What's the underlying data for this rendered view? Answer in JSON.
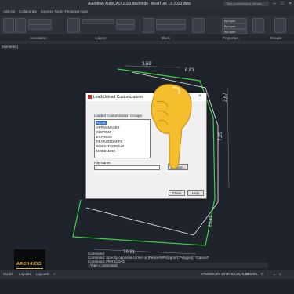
{
  "window": {
    "title": "Autodesk AutoCAD 2023  dashinde_WestTurk 19 2023.dwg",
    "search_placeholder": "Type a keyword or phrase"
  },
  "menu": {
    "items": [
      "Add-ins",
      "Collaborate",
      "Express Tools",
      "Featured Apps"
    ]
  },
  "ribbon": {
    "panels": [
      "Annotation",
      "Layers",
      "Block",
      "Properties",
      "Groups"
    ],
    "layer_value": "ByLayer"
  },
  "document_tab": "[Isometric]",
  "dimensions": {
    "d1": "3,59",
    "d2": "6,83",
    "d3": "2,67",
    "d4": "7,25",
    "d5": "13,47",
    "d6": "16,91"
  },
  "dialog": {
    "title": "Load/Unload Customizations",
    "group_label": "Loaded Customization Groups:",
    "groups": [
      "ACAD",
      "APPMANAGER",
      "CUSTOM",
      "EXPRESS",
      "FEATUREDAPPS",
      "INSIGHTSGROUP",
      "MODELDOC"
    ],
    "selected_index": 0,
    "file_label": "File Name:",
    "file_value": "",
    "browse": "Browse...",
    "close": "Close",
    "help": "Help"
  },
  "command": {
    "history": [
      "Command:",
      "Command: Specify opposite corner or [Fence/WPolygon/CPolygon]: *Cancel*",
      "Command: PERSLOAD"
    ],
    "prompt": "Type a command"
  },
  "status": {
    "coords": "6790000,00, 2279153,13, 0,00",
    "mode": "MODEL",
    "tabs": [
      "Model",
      "Layout1",
      "Layout2"
    ]
  },
  "logo": {
    "text": "ARCH-HOO"
  },
  "colors": {
    "polyline_green": "#3ed14a",
    "selection_white": "#e8e8e8",
    "selected_item": "#2f6fd1"
  }
}
